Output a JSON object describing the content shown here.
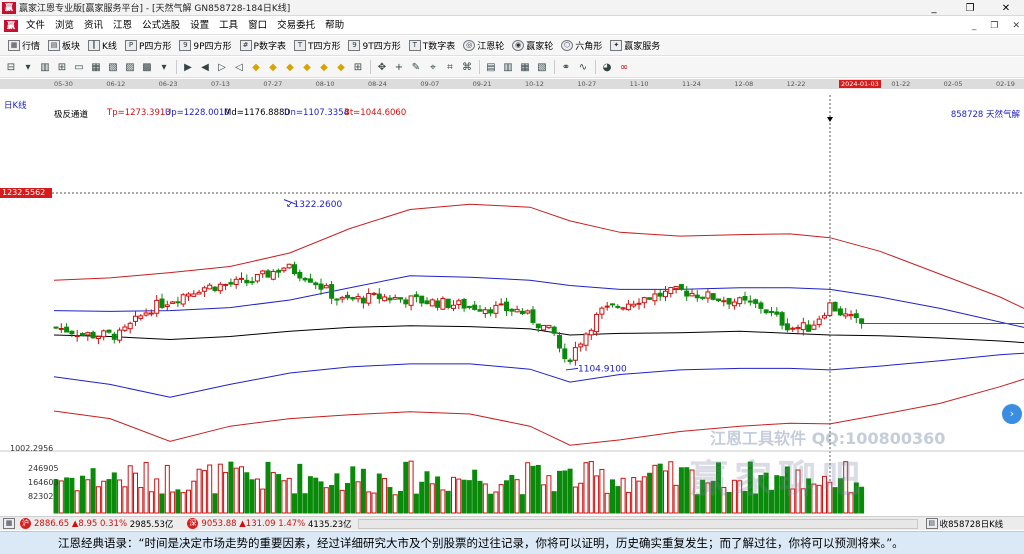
{
  "window": {
    "title": "赢家江恩专业版[赢家服务平台] - [天然气解   GN858728-184日K线]",
    "controls": [
      "_",
      "❐",
      "✕"
    ]
  },
  "menu": {
    "items": [
      "文件",
      "浏览",
      "资讯",
      "江恩",
      "公式选股",
      "设置",
      "工具",
      "窗口",
      "交易委托",
      "帮助"
    ],
    "right": [
      "_",
      "❐",
      "✕"
    ]
  },
  "toolbar1": {
    "items": [
      {
        "label": "行情",
        "icon": "grid-icon"
      },
      {
        "label": "板块",
        "icon": "blocks-icon"
      },
      {
        "label": "K线",
        "icon": "kline-icon"
      },
      {
        "label": "P四方形",
        "icon": "p4-icon"
      },
      {
        "label": "9P四方形",
        "icon": "9p4-icon"
      },
      {
        "label": "P数字表",
        "icon": "ptable-icon"
      },
      {
        "label": "T四方形",
        "icon": "t4-icon"
      },
      {
        "label": "9T四方形",
        "icon": "9t4-icon"
      },
      {
        "label": "T数字表",
        "icon": "ttable-icon"
      },
      {
        "label": "江恩轮",
        "icon": "wheel-icon"
      },
      {
        "label": "赢家轮",
        "icon": "wheel2-icon"
      },
      {
        "label": "六角形",
        "icon": "hexagon-icon"
      },
      {
        "label": "赢家服务",
        "icon": "service-icon"
      }
    ]
  },
  "datebar": {
    "dates": [
      "05-30",
      "06-12",
      "06-23",
      "07-13",
      "07-27",
      "08-10",
      "08-24",
      "09-07",
      "09-21",
      "10-12",
      "10-27",
      "11-10",
      "11-24",
      "12-08",
      "12-22",
      "2024-01-03",
      "01-22",
      "02-05",
      "02-19"
    ],
    "active": "2024-01-03"
  },
  "chart": {
    "period_label": "日K线",
    "indicator": "极反通道",
    "tp": "Tp=1273.3913",
    "up": "Up=1228.0010",
    "md": "Md=1176.8880",
    "dn": "Dn=1107.3354",
    "bt": "Bt=1044.6060",
    "code_name": "858728  天然气解",
    "price_tag": "1232.5562",
    "high_label": "1322.2600",
    "low_label": "1104.9100",
    "vol_top": "1002.2956",
    "vol_ticks": [
      "246905",
      "164603",
      "82302"
    ],
    "colors": {
      "up": "#d10f0f",
      "down": "#0a8a0a",
      "mid": "#000000",
      "band": "#1f22c7",
      "outer": "#c81f1f"
    }
  },
  "watermark": {
    "line1": "江恩工具软件 QQ:100800360",
    "line2": "赢家聊吧"
  },
  "statusbar": {
    "idx1_price": "2886.65",
    "idx1_change": "▲8.95",
    "idx1_pct": "0.31%",
    "idx1_amount": "2985.53亿",
    "idx2_price": "9053.88",
    "idx2_change": "▲131.09",
    "idx2_pct": "1.47%",
    "idx2_amount": "4135.23亿",
    "right": "收858728日K线"
  },
  "quote": {
    "text": "江恩经典语录：“时间是决定市场走势的重要因素，经过详细研究大市及个别股票的过往记录，你将可以证明，历史确实重复发生；而了解过往，你将可以预测将来。”。"
  }
}
